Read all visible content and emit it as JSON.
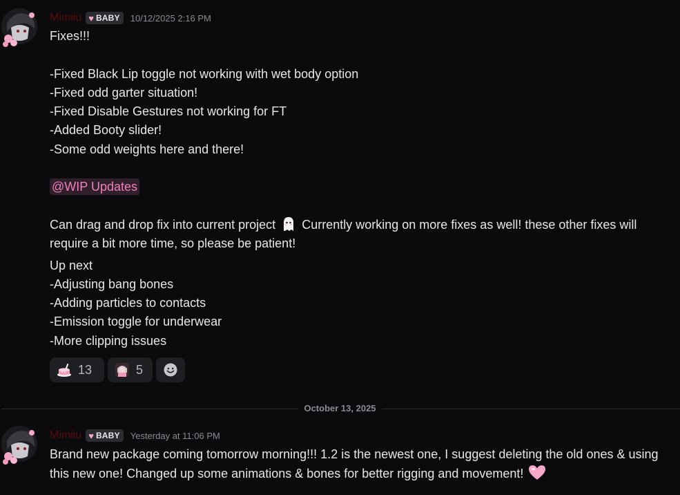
{
  "messages": [
    {
      "username": "Mimiiu",
      "role": "BABY",
      "timestamp": "10/12/2025 2:16 PM",
      "lines": [
        "Fixes!!!",
        "",
        "-Fixed Black Lip toggle not working with wet body option",
        "-Fixed odd garter situation!",
        "-Fixed Disable Gestures not working for FT",
        "-Added Booty slider!",
        "-Some odd weights here and there!",
        ""
      ],
      "mention": "@WIP Updates",
      "paragraph_before_emoji": "Can drag and drop fix into current project",
      "paragraph_after_emoji": "Currently working on more fixes as well! these other fixes will require a bit more time, so please be patient!",
      "up_next": [
        "Up next",
        "-Adjusting bang bones",
        "-Adding particles to contacts",
        "-Emission toggle for underwear",
        "-More clipping issues"
      ],
      "reactions": [
        {
          "emoji": "cake-emoji",
          "count": "13"
        },
        {
          "emoji": "character-emoji",
          "count": "5"
        }
      ]
    },
    {
      "username": "Mimiiu",
      "role": "BABY",
      "timestamp": "Yesterday at 11:06 PM",
      "text": "Brand new package coming tomorrow morning!!! 1.2 is the newest one, I suggest deleting the old ones & using this new one! Changed up some animations & bones for better rigging and movement!"
    }
  ],
  "date_divider": "October 13, 2025",
  "colors": {
    "background": "#0b0b0e",
    "username": "#5a0a0f",
    "mention_text": "#f47fbf",
    "mention_bg": "#2e1f2a",
    "timestamp": "#8a8c93"
  }
}
